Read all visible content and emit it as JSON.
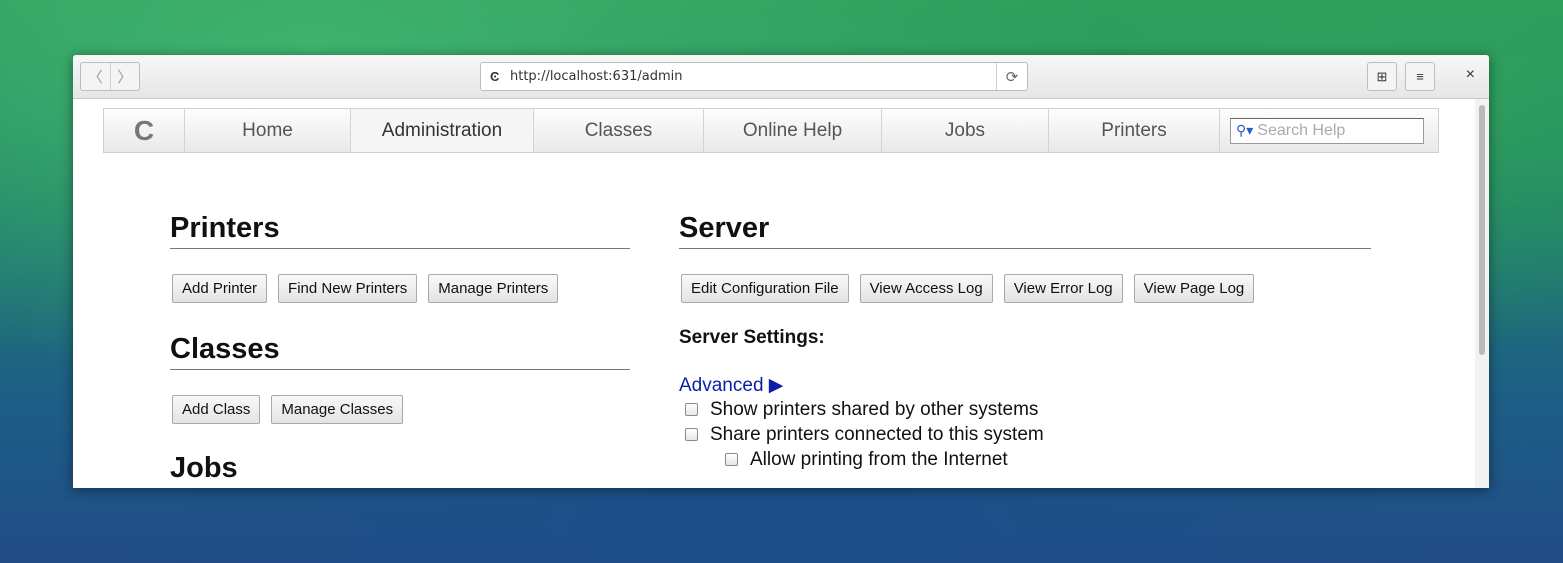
{
  "browser": {
    "url": "http://localhost:631/admin",
    "url_icon": "cups-icon",
    "back_glyph": "〈",
    "forward_glyph": "〉",
    "reload_glyph": "⟳",
    "bookmark_glyph": "⊞",
    "menu_glyph": "≡",
    "close_glyph": "×"
  },
  "nav": {
    "logo_glyph": "C",
    "tabs": [
      "Home",
      "Administration",
      "Classes",
      "Online Help",
      "Jobs",
      "Printers"
    ],
    "active_tab": "Administration",
    "search_placeholder": "Search Help",
    "search_icon_glyph": "🔍"
  },
  "printers": {
    "title": "Printers",
    "buttons": [
      "Add Printer",
      "Find New Printers",
      "Manage Printers"
    ]
  },
  "classes": {
    "title": "Classes",
    "buttons": [
      "Add Class",
      "Manage Classes"
    ]
  },
  "jobs": {
    "title": "Jobs"
  },
  "server": {
    "title": "Server",
    "buttons": [
      "Edit Configuration File",
      "View Access Log",
      "View Error Log",
      "View Page Log"
    ],
    "settings_label": "Server Settings:",
    "advanced_label": "Advanced ▶",
    "options": [
      {
        "label": "Show printers shared by other systems",
        "checked": false
      },
      {
        "label": "Share printers connected to this system",
        "checked": false
      },
      {
        "label": "Allow printing from the Internet",
        "checked": false
      }
    ]
  },
  "colors": {
    "link": "#0a1fa6"
  }
}
